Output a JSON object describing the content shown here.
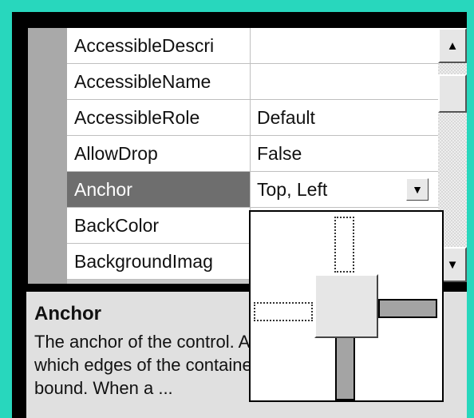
{
  "properties": [
    {
      "name": "AccessibleDescription",
      "display_name": "AccessibleDescri",
      "value": ""
    },
    {
      "name": "AccessibleName",
      "display_name": "AccessibleName",
      "value": ""
    },
    {
      "name": "AccessibleRole",
      "display_name": "AccessibleRole",
      "value": "Default"
    },
    {
      "name": "AllowDrop",
      "display_name": "AllowDrop",
      "value": "False"
    },
    {
      "name": "Anchor",
      "display_name": "Anchor",
      "value": "Top, Left",
      "selected": true
    },
    {
      "name": "BackColor",
      "display_name": "BackColor",
      "value": ""
    },
    {
      "name": "BackgroundImage",
      "display_name": "BackgroundImag",
      "value": ""
    }
  ],
  "scrollbar": {
    "up_glyph": "▲",
    "down_glyph": "▼"
  },
  "dropdown": {
    "glyph": "▼"
  },
  "help": {
    "title": "Anchor",
    "text": "The anchor of the control. Anchors define to which edges of the container a certain control is bound. When a ..."
  },
  "anchor_editor": {
    "top": "anchored",
    "left": "anchored",
    "right": "not-anchored",
    "bottom": "not-anchored"
  },
  "colors": {
    "background": "#28d7bd",
    "selected_row": "#6e6e6e"
  }
}
